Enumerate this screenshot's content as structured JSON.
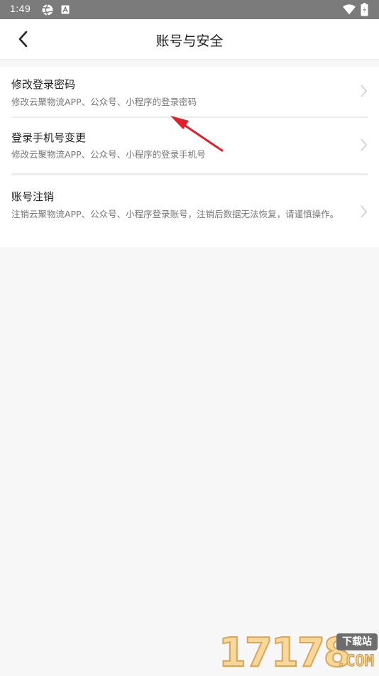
{
  "status_bar": {
    "time": "1:49",
    "icons": [
      "aperture-icon",
      "font-a-icon",
      "wifi-icon",
      "battery-icon"
    ]
  },
  "header": {
    "title": "账号与安全",
    "back_icon": "chevron-left-icon"
  },
  "items": [
    {
      "title": "修改登录密码",
      "description": "修改云聚物流APP、公众号、小程序的登录密码"
    },
    {
      "title": "登录手机号变更",
      "description": "修改云聚物流APP、公众号、小程序的登录手机号"
    },
    {
      "title": "账号注销",
      "description": "注销云聚物流APP、公众号、小程序登录账号，注销后数据无法恢复，请谨慎操作。"
    }
  ],
  "watermark": {
    "digits": "17178",
    "badge": "下载站",
    "domain": ".COM"
  },
  "colors": {
    "status_bar": "#7b7b7b",
    "page_background": "#f7f7f7",
    "annotation_arrow": "#e0202a"
  }
}
